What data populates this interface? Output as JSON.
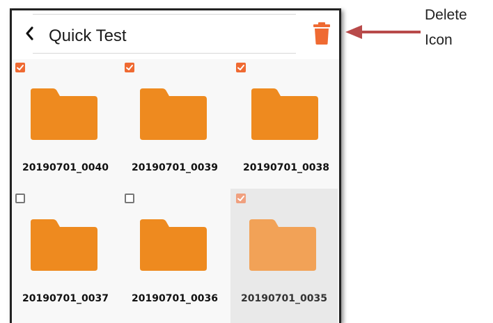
{
  "header": {
    "title": "Quick Test",
    "back_icon": "chevron-left-icon",
    "delete_icon": "trash-icon"
  },
  "folders": [
    {
      "name": "20190701_0040",
      "checked": true,
      "dimmed": false
    },
    {
      "name": "20190701_0039",
      "checked": true,
      "dimmed": false
    },
    {
      "name": "20190701_0038",
      "checked": true,
      "dimmed": false
    },
    {
      "name": "20190701_0037",
      "checked": false,
      "dimmed": false
    },
    {
      "name": "20190701_0036",
      "checked": false,
      "dimmed": false
    },
    {
      "name": "20190701_0035",
      "checked": true,
      "dimmed": true
    }
  ],
  "annotation": {
    "line1": "Delete",
    "line2": "Icon"
  },
  "colors": {
    "accent": "#ef6a32",
    "folder": "#ee8a1f",
    "folder_dim": "#f2a257",
    "arrow": "#b84a4a"
  }
}
